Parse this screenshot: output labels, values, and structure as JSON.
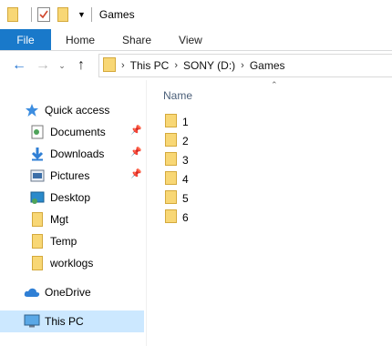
{
  "window": {
    "title": "Games"
  },
  "ribbon": {
    "tabs": [
      "File",
      "Home",
      "Share",
      "View"
    ]
  },
  "address": {
    "crumbs": [
      "This PC",
      "SONY (D:)",
      "Games"
    ]
  },
  "nav": {
    "quick_access": "Quick access",
    "items": [
      {
        "label": "Documents",
        "icon": "documents-icon",
        "pinned": true
      },
      {
        "label": "Downloads",
        "icon": "downloads-icon",
        "pinned": true
      },
      {
        "label": "Pictures",
        "icon": "pictures-icon",
        "pinned": true
      },
      {
        "label": "Desktop",
        "icon": "desktop-icon",
        "pinned": false
      },
      {
        "label": "Mgt",
        "icon": "folder-icon",
        "pinned": false
      },
      {
        "label": "Temp",
        "icon": "folder-icon",
        "pinned": false
      },
      {
        "label": "worklogs",
        "icon": "folder-icon",
        "pinned": false
      }
    ],
    "onedrive": "OneDrive",
    "thispc": "This PC"
  },
  "content": {
    "column_header": "Name",
    "files": [
      "1",
      "2",
      "3",
      "4",
      "5",
      "6"
    ]
  },
  "colors": {
    "file_tab": "#1979ca",
    "folder": "#f8d775",
    "selected": "#cce8ff"
  }
}
